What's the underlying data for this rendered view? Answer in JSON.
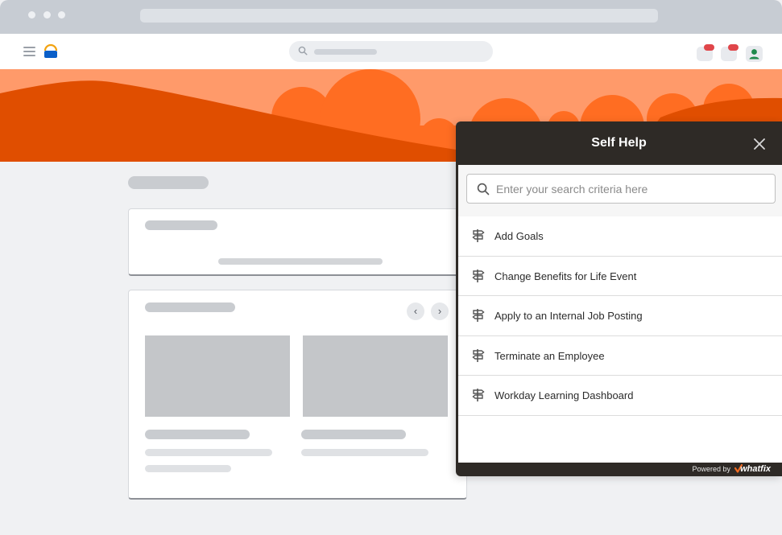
{
  "browser": {
    "window_dots": [
      "dot",
      "dot",
      "dot"
    ]
  },
  "app": {
    "search_icon": "search-icon",
    "menu_icon": "hamburger-menu-icon",
    "logo_icon": "app-logo-icon",
    "notification_icons": [
      "notification-icon",
      "chat-icon"
    ],
    "avatar_icon": "user-avatar-icon",
    "colors": {
      "banner_light": "#ff9a6a",
      "banner_mid": "#ff6d22",
      "banner_dark": "#e04e00",
      "badge": "#e0464a"
    }
  },
  "carousel": {
    "prev_label": "‹",
    "next_label": "›"
  },
  "self_help": {
    "title": "Self Help",
    "close_icon": "close-icon",
    "search_placeholder": "Enter your search criteria here",
    "flow_icon": "signpost-icon",
    "items": [
      {
        "label": "Add Goals"
      },
      {
        "label": "Change Benefits for Life Event"
      },
      {
        "label": "Apply to an Internal Job Posting"
      },
      {
        "label": "Terminate an Employee"
      },
      {
        "label": "Workday Learning Dashboard"
      }
    ],
    "footer": {
      "powered_by": "Powered by",
      "brand": "whatfix"
    },
    "colors": {
      "header_bg": "#2e2a26",
      "header_text": "#ffffff",
      "brand_accent": "#f26b21"
    }
  }
}
